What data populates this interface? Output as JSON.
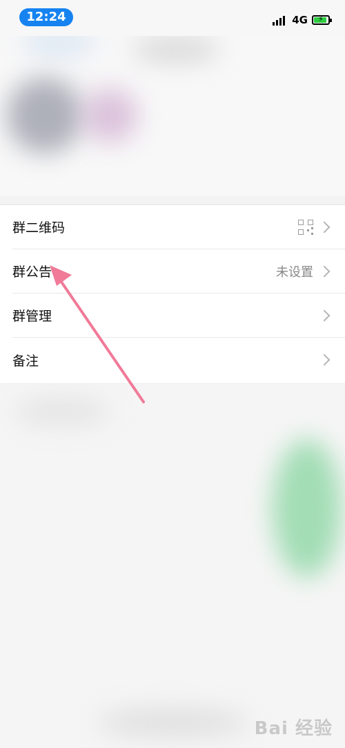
{
  "status_bar": {
    "time": "12:24",
    "network": "4G",
    "signal_icon": "signal-bars-icon",
    "battery_icon": "battery-charging-icon",
    "battery_level": 0.8,
    "colors": {
      "time_pill": "#1683f0",
      "battery_fill": "#2ecc40"
    }
  },
  "settings": {
    "items": [
      {
        "label": "群二维码",
        "value": "",
        "icon": "qr-code-icon",
        "chevron": "chevron-right-icon"
      },
      {
        "label": "群公告",
        "value": "未设置",
        "icon": "",
        "chevron": "chevron-right-icon"
      },
      {
        "label": "群管理",
        "value": "",
        "icon": "",
        "chevron": "chevron-right-icon"
      },
      {
        "label": "备注",
        "value": "",
        "icon": "",
        "chevron": "chevron-right-icon"
      }
    ]
  },
  "annotation": {
    "arrow_color": "#f07a98",
    "target": "群公告"
  },
  "watermark": {
    "text": "Bai 经验"
  }
}
